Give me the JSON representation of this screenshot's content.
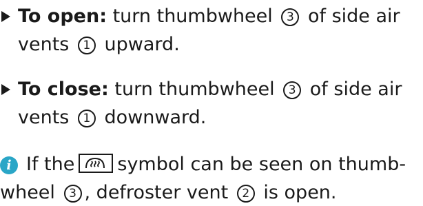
{
  "steps": [
    {
      "keyword": "To open:",
      "line1_a": "turn thumbwheel",
      "thumbwheel_num": "3",
      "line1_b": "of side air",
      "line2_a": "vents",
      "vent_num": "1",
      "line2_b": "upward."
    },
    {
      "keyword": "To close:",
      "line1_a": "turn thumbwheel",
      "thumbwheel_num": "3",
      "line1_b": "of side air",
      "line2_a": "vents",
      "vent_num": "1",
      "line2_b": "downward."
    }
  ],
  "note": {
    "icon": "info-icon",
    "icon_letter": "i",
    "icon_color": "#2aa6c7",
    "line1_a": "If the",
    "symbol": "defroster-symbol",
    "line1_b": "symbol can be seen on thumb-",
    "line2_a": "wheel",
    "thumbwheel_num": "3",
    "line2_b": ", defroster vent",
    "vent_num": "2",
    "line2_c": "is open."
  }
}
